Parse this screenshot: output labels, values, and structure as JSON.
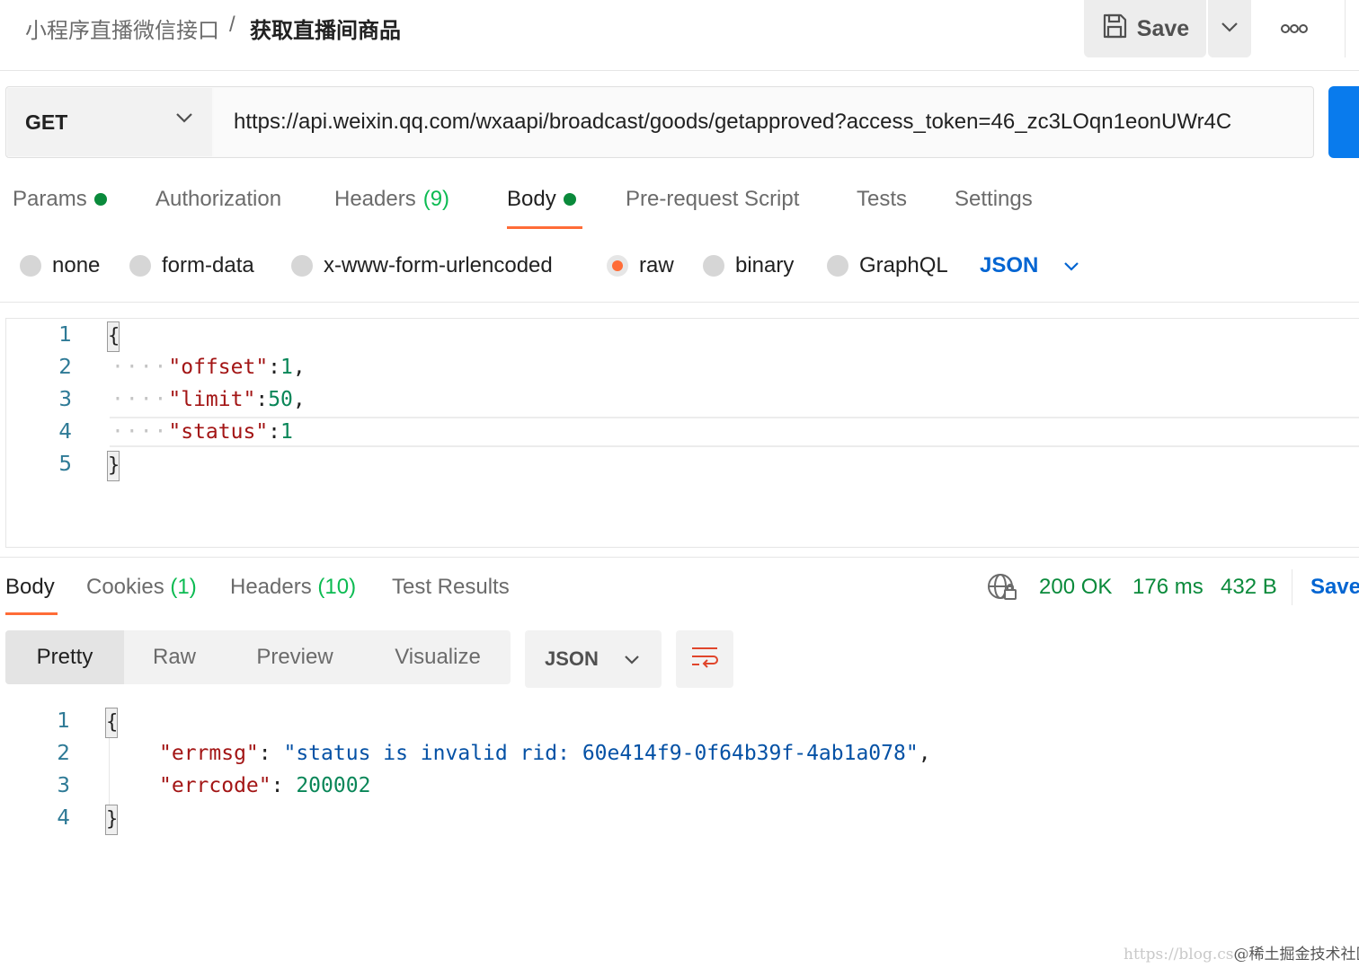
{
  "header": {
    "breadcrumb_parent": "小程序直播微信接口",
    "breadcrumb_separator": "/",
    "breadcrumb_current": "获取直播间商品",
    "save_label": "Save",
    "more_label": "ooo"
  },
  "request": {
    "method": "GET",
    "url": "https://api.weixin.qq.com/wxaapi/broadcast/goods/getapproved?access_token=46_zc3LOqn1eonUWr4C",
    "tabs": [
      {
        "label": "Params",
        "dot": true
      },
      {
        "label": "Authorization"
      },
      {
        "label": "Headers",
        "count": "(9)"
      },
      {
        "label": "Body",
        "dot": true,
        "active": true
      },
      {
        "label": "Pre-request Script"
      },
      {
        "label": "Tests"
      },
      {
        "label": "Settings"
      }
    ],
    "body_types": [
      "none",
      "form-data",
      "x-www-form-urlencoded",
      "raw",
      "binary",
      "GraphQL"
    ],
    "body_type_selected": "raw",
    "body_format": "JSON",
    "body_lines": {
      "numbers": [
        "1",
        "2",
        "3",
        "4",
        "5"
      ],
      "open_brace": "{",
      "close_brace": "}",
      "line2_key": "\"offset\"",
      "line2_colon": ":",
      "line2_value": "1",
      "line2_comma": ",",
      "line3_key": "\"limit\"",
      "line3_colon": ":",
      "line3_value": "50",
      "line3_comma": ",",
      "line4_key": "\"status\"",
      "line4_colon": ":",
      "line4_value": "1"
    }
  },
  "response": {
    "tabs": [
      {
        "label": "Body",
        "active": true
      },
      {
        "label": "Cookies",
        "count": "(1)"
      },
      {
        "label": "Headers",
        "count": "(10)"
      },
      {
        "label": "Test Results"
      }
    ],
    "status": "200 OK",
    "time": "176 ms",
    "size": "432 B",
    "save_label": "Save",
    "views": [
      "Pretty",
      "Raw",
      "Preview",
      "Visualize"
    ],
    "view_selected": "Pretty",
    "format": "JSON",
    "body_lines": {
      "numbers": [
        "1",
        "2",
        "3",
        "4"
      ],
      "open_brace": "{",
      "close_brace": "}",
      "line2_key": "\"errmsg\"",
      "line2_colon": ": ",
      "line2_value": "\"status is invalid rid: 60e414f9-0f64b39f-4ab1a078\"",
      "line2_comma": ",",
      "line3_key": "\"errcode\"",
      "line3_colon": ": ",
      "line3_value": "200002"
    }
  },
  "watermark": {
    "url": "https://blog.cs",
    "site": "@稀土掘金技术社区"
  },
  "colors": {
    "accent_orange": "#ff6c37",
    "link_blue": "#0265d2",
    "status_green": "#0a8a3b",
    "send_blue": "#097bed"
  }
}
